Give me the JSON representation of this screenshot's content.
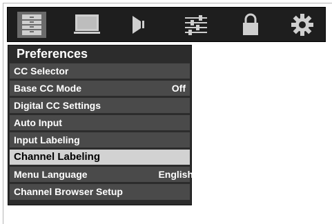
{
  "icon_bar": {
    "icons": [
      "setup-icon",
      "picture-icon",
      "audio-icon",
      "settings-sliders-icon",
      "lock-icon",
      "gear-icon"
    ],
    "active_index": 0,
    "colors": {
      "background": "#1e1e1e",
      "active": "#6b6b6b",
      "icon": "#cfcfcf"
    }
  },
  "menu": {
    "title": "Preferences",
    "items": [
      {
        "label": "CC Selector",
        "value": ""
      },
      {
        "label": "Base CC Mode",
        "value": "Off"
      },
      {
        "label": "Digital CC Settings",
        "value": ""
      },
      {
        "label": "Auto Input",
        "value": ""
      },
      {
        "label": "Input Labeling",
        "value": ""
      },
      {
        "label": "Channel Labeling",
        "value": "",
        "selected": true
      },
      {
        "label": "Menu Language",
        "value": "English"
      },
      {
        "label": "Channel Browser Setup",
        "value": ""
      }
    ],
    "colors": {
      "panel": "#2c2c2c",
      "item": "#4a4a4a",
      "selected": "#d2d2d2"
    }
  }
}
